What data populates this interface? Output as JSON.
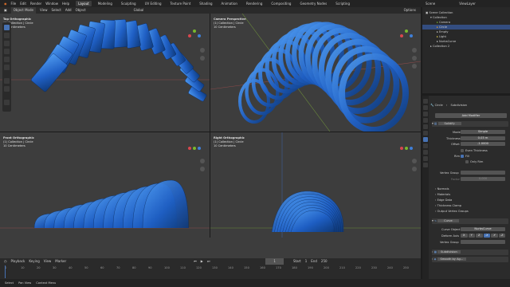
{
  "topbar": {
    "menus": [
      "File",
      "Edit",
      "Render",
      "Window",
      "Help"
    ],
    "workspaces": [
      "Layout",
      "Modeling",
      "Sculpting",
      "UV Editing",
      "Texture Paint",
      "Shading",
      "Animation",
      "Rendering",
      "Compositing",
      "Geometry Nodes",
      "Scripting"
    ],
    "active_workspace": "Layout",
    "scene": "Scene",
    "view_layer": "ViewLayer"
  },
  "viewport_header": {
    "mode": "Object Mode",
    "menus": [
      "View",
      "Select",
      "Add",
      "Object"
    ],
    "orientation": "Global",
    "options": "Options"
  },
  "viewports": [
    {
      "title": "Top Orthographic",
      "collection": "(1) Collection | Circle",
      "units": "10 Centimeters"
    },
    {
      "title": "Camera Perspective",
      "collection": "(1) Collection | Circle",
      "units": "10 Centimeters"
    },
    {
      "title": "Front Orthographic",
      "collection": "(1) Collection | Circle",
      "units": "10 Centimeters"
    },
    {
      "title": "Right Orthographic",
      "collection": "(1) Collection | Circle",
      "units": "10 Centimeters"
    }
  ],
  "outliner": {
    "root": "Scene Collection",
    "items": [
      "Collection",
      "Camera",
      "Circle",
      "Empty",
      "Light",
      "NurbsCurve",
      "Collection 2"
    ]
  },
  "properties": {
    "object_name": "Circle",
    "modifier_context": "Subdivision",
    "add_modifier": "Add Modifier",
    "solidify": {
      "name": "Solidify",
      "mode_label": "Mode",
      "mode_value": "Simple",
      "thickness_label": "Thickness",
      "thickness_value": "0.03 m",
      "offset_label": "Offset",
      "offset_value": "-1.0000",
      "even_thickness": "Even Thickness",
      "rim_label": "Rim",
      "rim_fill": "Fill",
      "only_rim": "Only Rim",
      "vertex_group": "Vertex Group",
      "factor_label": "Factor",
      "factor_value": "0.000",
      "sections": [
        "Normals",
        "Materials",
        "Edge Data",
        "Thickness Clamp",
        "Output Vertex Groups"
      ]
    },
    "curve": {
      "name": "Curve",
      "curve_object_label": "Curve Object",
      "curve_object_value": "NurbsCurve",
      "deform_axis": "Deform Axis",
      "axes": [
        "X",
        "Y",
        "Z",
        "-X",
        "-Y",
        "-Z"
      ],
      "vertex_group": "Vertex Group"
    },
    "subdivision": {
      "name": "Subdivision"
    },
    "smooth": {
      "name": "Smooth by Ag..."
    }
  },
  "timeline": {
    "menus": [
      "Playback",
      "Keying",
      "View",
      "Marker"
    ],
    "current_frame": "1",
    "start_label": "Start",
    "start": "1",
    "end_label": "End",
    "end": "250",
    "ticks": [
      "0",
      "10",
      "20",
      "30",
      "40",
      "50",
      "60",
      "70",
      "80",
      "90",
      "100",
      "110",
      "120",
      "130",
      "140",
      "150",
      "160",
      "170",
      "180",
      "190",
      "200",
      "210",
      "220",
      "230",
      "240",
      "250"
    ]
  },
  "statusbar": {
    "items": [
      "Select",
      "Pan View",
      "Context Menu"
    ]
  },
  "colors": {
    "accent": "#4772b3",
    "mesh_dark": "#0f3a7a",
    "mesh_light": "#4f9bf0",
    "axis_x": "#d8474d",
    "axis_y": "#7ab82d",
    "axis_z": "#3f7fd8"
  }
}
